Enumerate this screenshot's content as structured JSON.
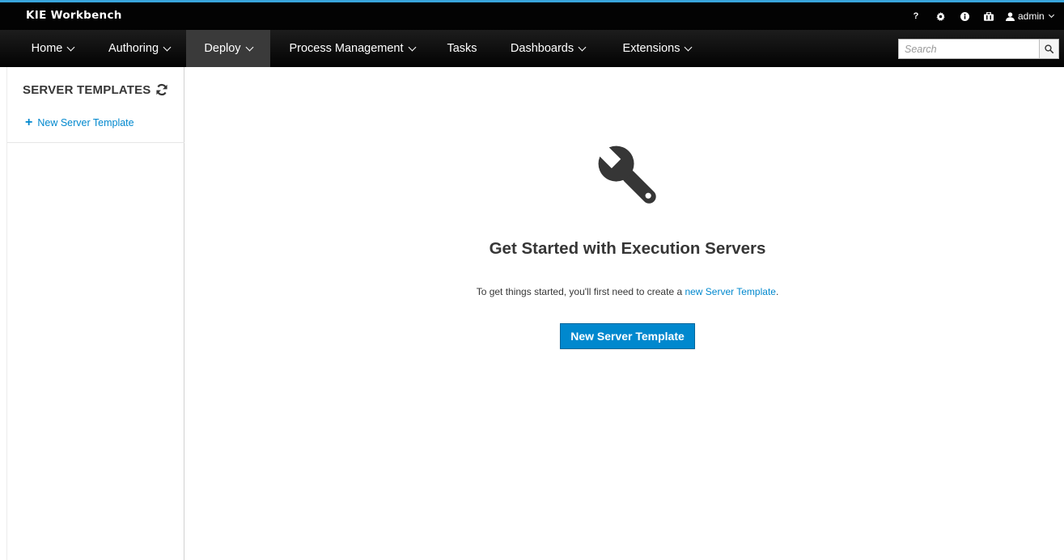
{
  "app": {
    "brand": "KIE Workbench"
  },
  "colors": {
    "accent": "#0088ce",
    "topbar": "#030303",
    "active_nav": "#3a3a3a",
    "accent_line": "#39a5dc"
  },
  "utility": {
    "help_label": "?",
    "icons": [
      "help-icon",
      "gear-icon",
      "info-icon",
      "briefcase-icon",
      "user-icon"
    ],
    "user_label": "admin"
  },
  "nav": {
    "items": [
      {
        "label": "Home",
        "dropdown": true
      },
      {
        "label": "Authoring",
        "dropdown": true
      },
      {
        "label": "Deploy",
        "dropdown": true,
        "active": true
      },
      {
        "label": "Process Management",
        "dropdown": true
      },
      {
        "label": "Tasks",
        "dropdown": false
      },
      {
        "label": "Dashboards",
        "dropdown": true
      },
      {
        "label": "Extensions",
        "dropdown": true
      }
    ],
    "search": {
      "placeholder": "Search",
      "value": ""
    }
  },
  "sidebar": {
    "title": "SERVER TEMPLATES",
    "new_label": "New Server Template"
  },
  "main": {
    "icon": "wrench-icon",
    "heading": "Get Started with Execution Servers",
    "desc_prefix": "To get things started, you'll first need to create a ",
    "desc_link": "new Server Template",
    "desc_suffix": ".",
    "button_label": "New Server Template"
  }
}
